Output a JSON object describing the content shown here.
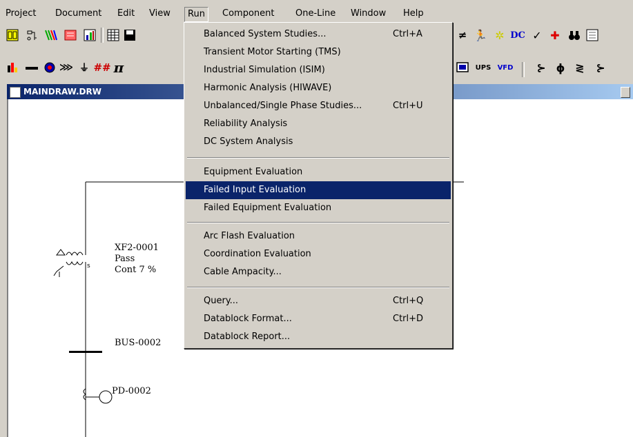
{
  "menubar": {
    "items": [
      "Project",
      "Document",
      "Edit",
      "View",
      "Run",
      "Component",
      "One-Line",
      "Window",
      "Help"
    ],
    "active": "Run"
  },
  "toolbar_row2": {
    "ups_label": "UPS",
    "vfd_label": "VFD",
    "dc_label": "DC"
  },
  "toolbar_row3": {
    "pi_symbol": "π"
  },
  "window": {
    "title": "MAINDRAW.DRW"
  },
  "diagram": {
    "transformer": {
      "id": "XF2-0001",
      "status": "Pass",
      "detail": "Cont 7 %"
    },
    "bus": {
      "id": "BUS-0002"
    },
    "pd": {
      "id": "PD-0002"
    }
  },
  "run_menu": {
    "groups": [
      [
        {
          "label": "Balanced System Studies...",
          "shortcut": "Ctrl+A"
        },
        {
          "label": "Transient Motor Starting (TMS)",
          "shortcut": ""
        },
        {
          "label": "Industrial Simulation (ISIM)",
          "shortcut": ""
        },
        {
          "label": "Harmonic Analysis (HIWAVE)",
          "shortcut": ""
        },
        {
          "label": "Unbalanced/Single Phase Studies...",
          "shortcut": "Ctrl+U"
        },
        {
          "label": "Reliability Analysis",
          "shortcut": ""
        },
        {
          "label": "DC System Analysis",
          "shortcut": ""
        }
      ],
      [
        {
          "label": "Equipment Evaluation",
          "shortcut": ""
        },
        {
          "label": "Failed Input Evaluation",
          "shortcut": "",
          "highlighted": true
        },
        {
          "label": "Failed Equipment Evaluation",
          "shortcut": ""
        }
      ],
      [
        {
          "label": "Arc Flash Evaluation",
          "shortcut": ""
        },
        {
          "label": "Coordination Evaluation",
          "shortcut": ""
        },
        {
          "label": "Cable Ampacity...",
          "shortcut": ""
        }
      ],
      [
        {
          "label": "Query...",
          "shortcut": "Ctrl+Q"
        },
        {
          "label": "Datablock Format...",
          "shortcut": "Ctrl+D"
        },
        {
          "label": "Datablock Report...",
          "shortcut": ""
        }
      ]
    ]
  },
  "colors": {
    "menu_highlight": "#0a246a",
    "title_gradient_start": "#0a246a",
    "title_gradient_end": "#a6caf0"
  }
}
